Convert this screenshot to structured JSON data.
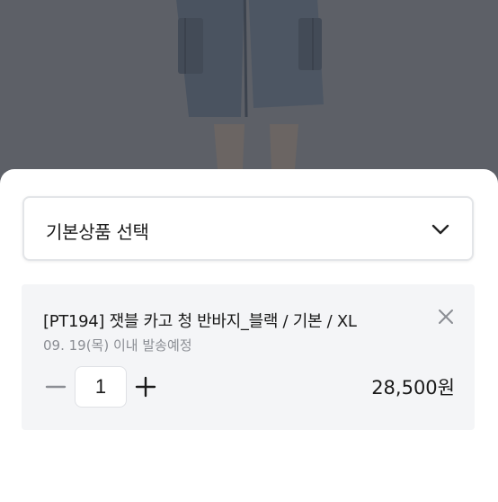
{
  "backdrop": {
    "image_subject": "denim cargo shorts product photo"
  },
  "option_selector": {
    "label": "기본상품 선택",
    "icon": "chevron-down-icon"
  },
  "selected_option": {
    "title": "[PT194] 잿블 카고 청 반바지_블랙 / 기본 / XL",
    "delivery": "09. 19(목) 이내 발송예정",
    "quantity": "1",
    "price": "28,500원",
    "remove_icon": "close-icon",
    "decrease_icon": "minus-icon",
    "increase_icon": "plus-icon"
  },
  "colors": {
    "overlay": "#5d6067",
    "card_background": "#f4f5f7",
    "text": "#1a1a1a",
    "muted_text": "#8b8e94"
  }
}
